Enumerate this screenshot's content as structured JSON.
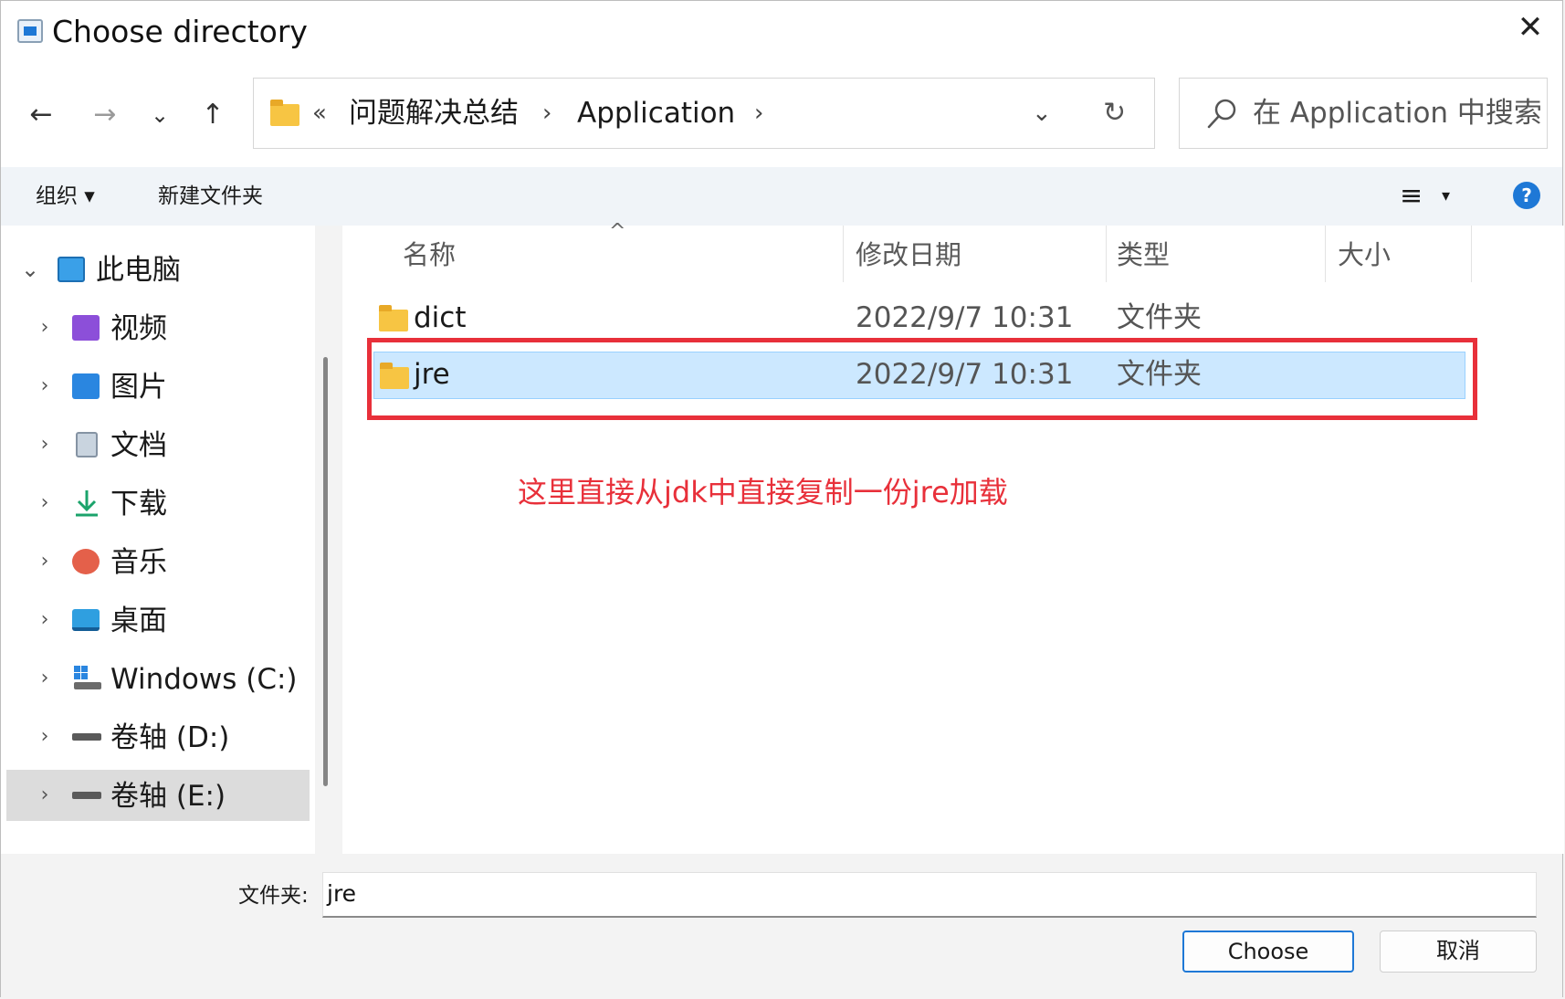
{
  "window": {
    "title": "Choose directory",
    "close_label": "✕"
  },
  "nav": {
    "back": "←",
    "forward": "→",
    "recent": "⌄",
    "up": "↑"
  },
  "address": {
    "overflow": "«",
    "crumbs": [
      "问题解决总结",
      "Application"
    ],
    "separator": "›",
    "dropdown": "⌄",
    "refresh": "↻"
  },
  "search": {
    "placeholder": "在 Application 中搜索"
  },
  "commands": {
    "organize": "组织 ▾",
    "new_folder": "新建文件夹",
    "view_icon": "≡",
    "view_dropdown": "▾",
    "help": "?"
  },
  "sidebar": {
    "items": [
      {
        "label": "此电脑",
        "expanded": true,
        "icon": "computer-icon"
      },
      {
        "label": "视频",
        "icon": "videos-icon"
      },
      {
        "label": "图片",
        "icon": "pictures-icon"
      },
      {
        "label": "文档",
        "icon": "documents-icon"
      },
      {
        "label": "下载",
        "icon": "downloads-icon"
      },
      {
        "label": "音乐",
        "icon": "music-icon"
      },
      {
        "label": "桌面",
        "icon": "desktop-icon"
      },
      {
        "label": "Windows (C:)",
        "icon": "windows-drive-icon"
      },
      {
        "label": "卷轴 (D:)",
        "icon": "drive-icon"
      },
      {
        "label": "卷轴 (E:)",
        "icon": "drive-icon",
        "selected": true
      }
    ],
    "chevron_expanded": "⌄",
    "chevron_collapsed": "›"
  },
  "columns": {
    "name": "名称",
    "modified": "修改日期",
    "type": "类型",
    "size": "大小",
    "sort_indicator": "^"
  },
  "files": [
    {
      "name": "dict",
      "modified": "2022/9/7 10:31",
      "type": "文件夹",
      "size": ""
    },
    {
      "name": "jre",
      "modified": "2022/9/7 10:31",
      "type": "文件夹",
      "size": "",
      "selected": true
    }
  ],
  "annotation": {
    "text": "这里直接从jdk中直接复制一份jre加载",
    "color": "#e8303a"
  },
  "footer": {
    "folder_label": "文件夹:",
    "folder_value": "jre",
    "choose_label": "Choose",
    "cancel_label": "取消"
  },
  "colors": {
    "accent": "#1e78d6",
    "selection": "#cce8ff",
    "annotation_red": "#e8303a"
  }
}
